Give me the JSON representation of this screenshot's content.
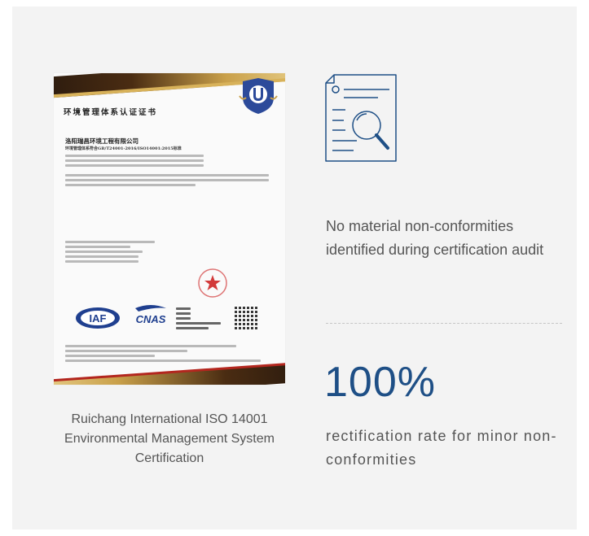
{
  "certificate": {
    "title": "环境管理体系认证证书",
    "company": "洛阳瑞昌环境工程有限公司",
    "standard": "环境管理体系符合GB/T24001-2016/ISO14001:2015标准",
    "logos": {
      "iaf": "IAF",
      "cnas": "CNAS"
    },
    "caption": "Ruichang International ISO 14001 Environmental Management System Certification"
  },
  "icons": {
    "document": "document-search-icon"
  },
  "audit_text": "No material non-conformities identified during certification audit",
  "stat": {
    "value": "100%",
    "description": "rectification rate for minor non-conformities"
  },
  "colors": {
    "accent": "#1e4f86",
    "panel_bg": "#f3f3f3",
    "text": "#555555"
  }
}
